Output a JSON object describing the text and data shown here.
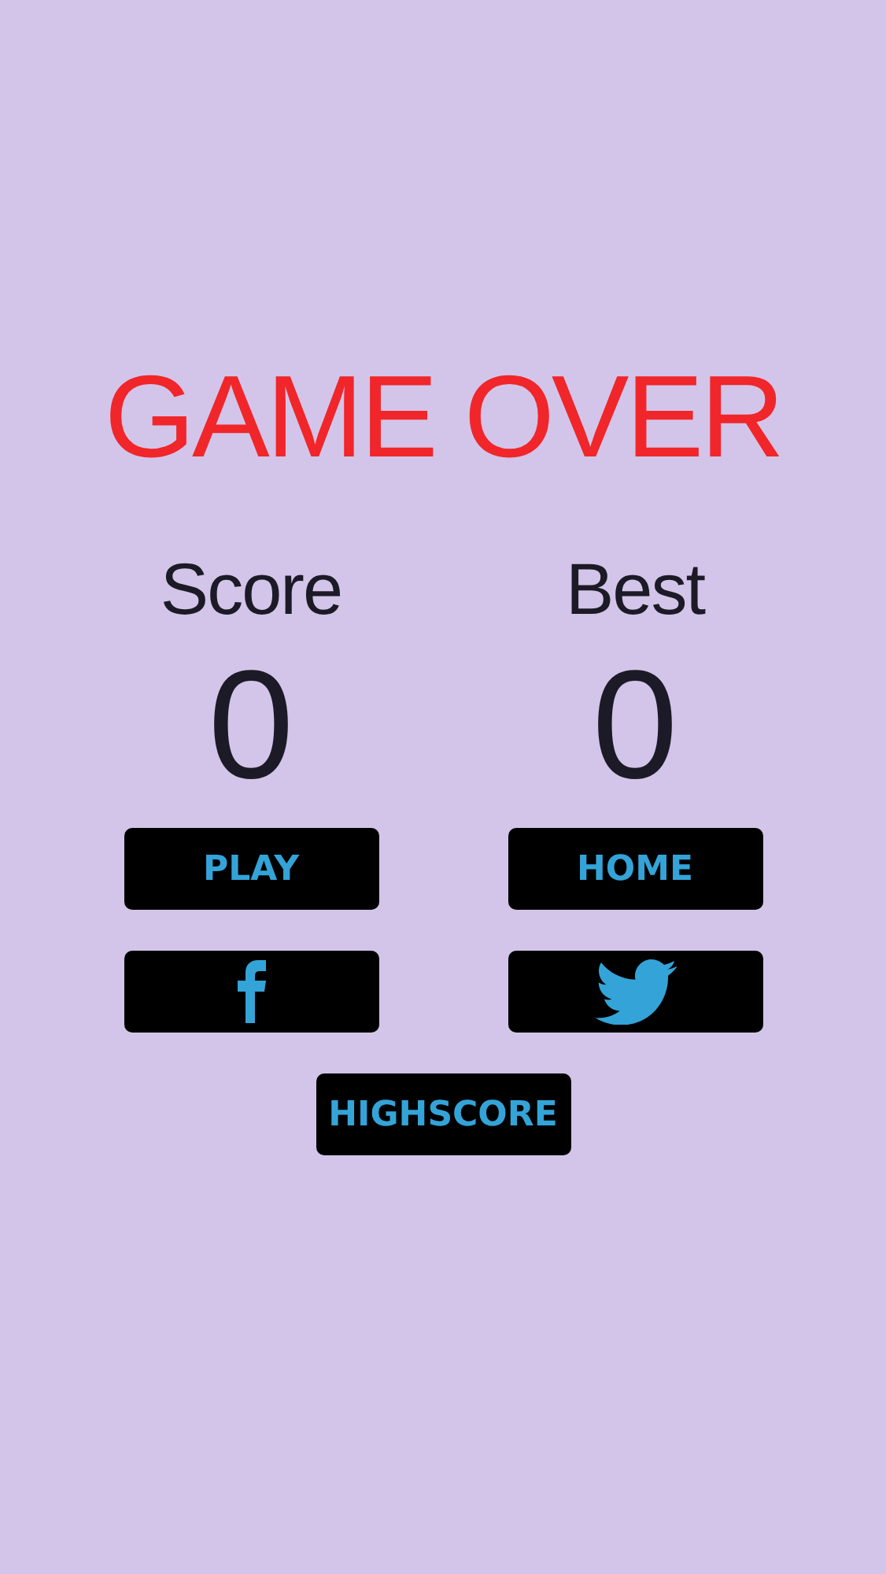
{
  "title": "GAME OVER",
  "stats": [
    {
      "label": "Score",
      "value": "0"
    },
    {
      "label": "Best",
      "value": "0"
    }
  ],
  "buttons": [
    {
      "kind": "text",
      "label": "PLAY"
    },
    {
      "kind": "text",
      "label": "HOME"
    },
    {
      "kind": "facebook"
    },
    {
      "kind": "twitter"
    },
    {
      "kind": "text",
      "label": "HIGHSCORE"
    }
  ]
}
